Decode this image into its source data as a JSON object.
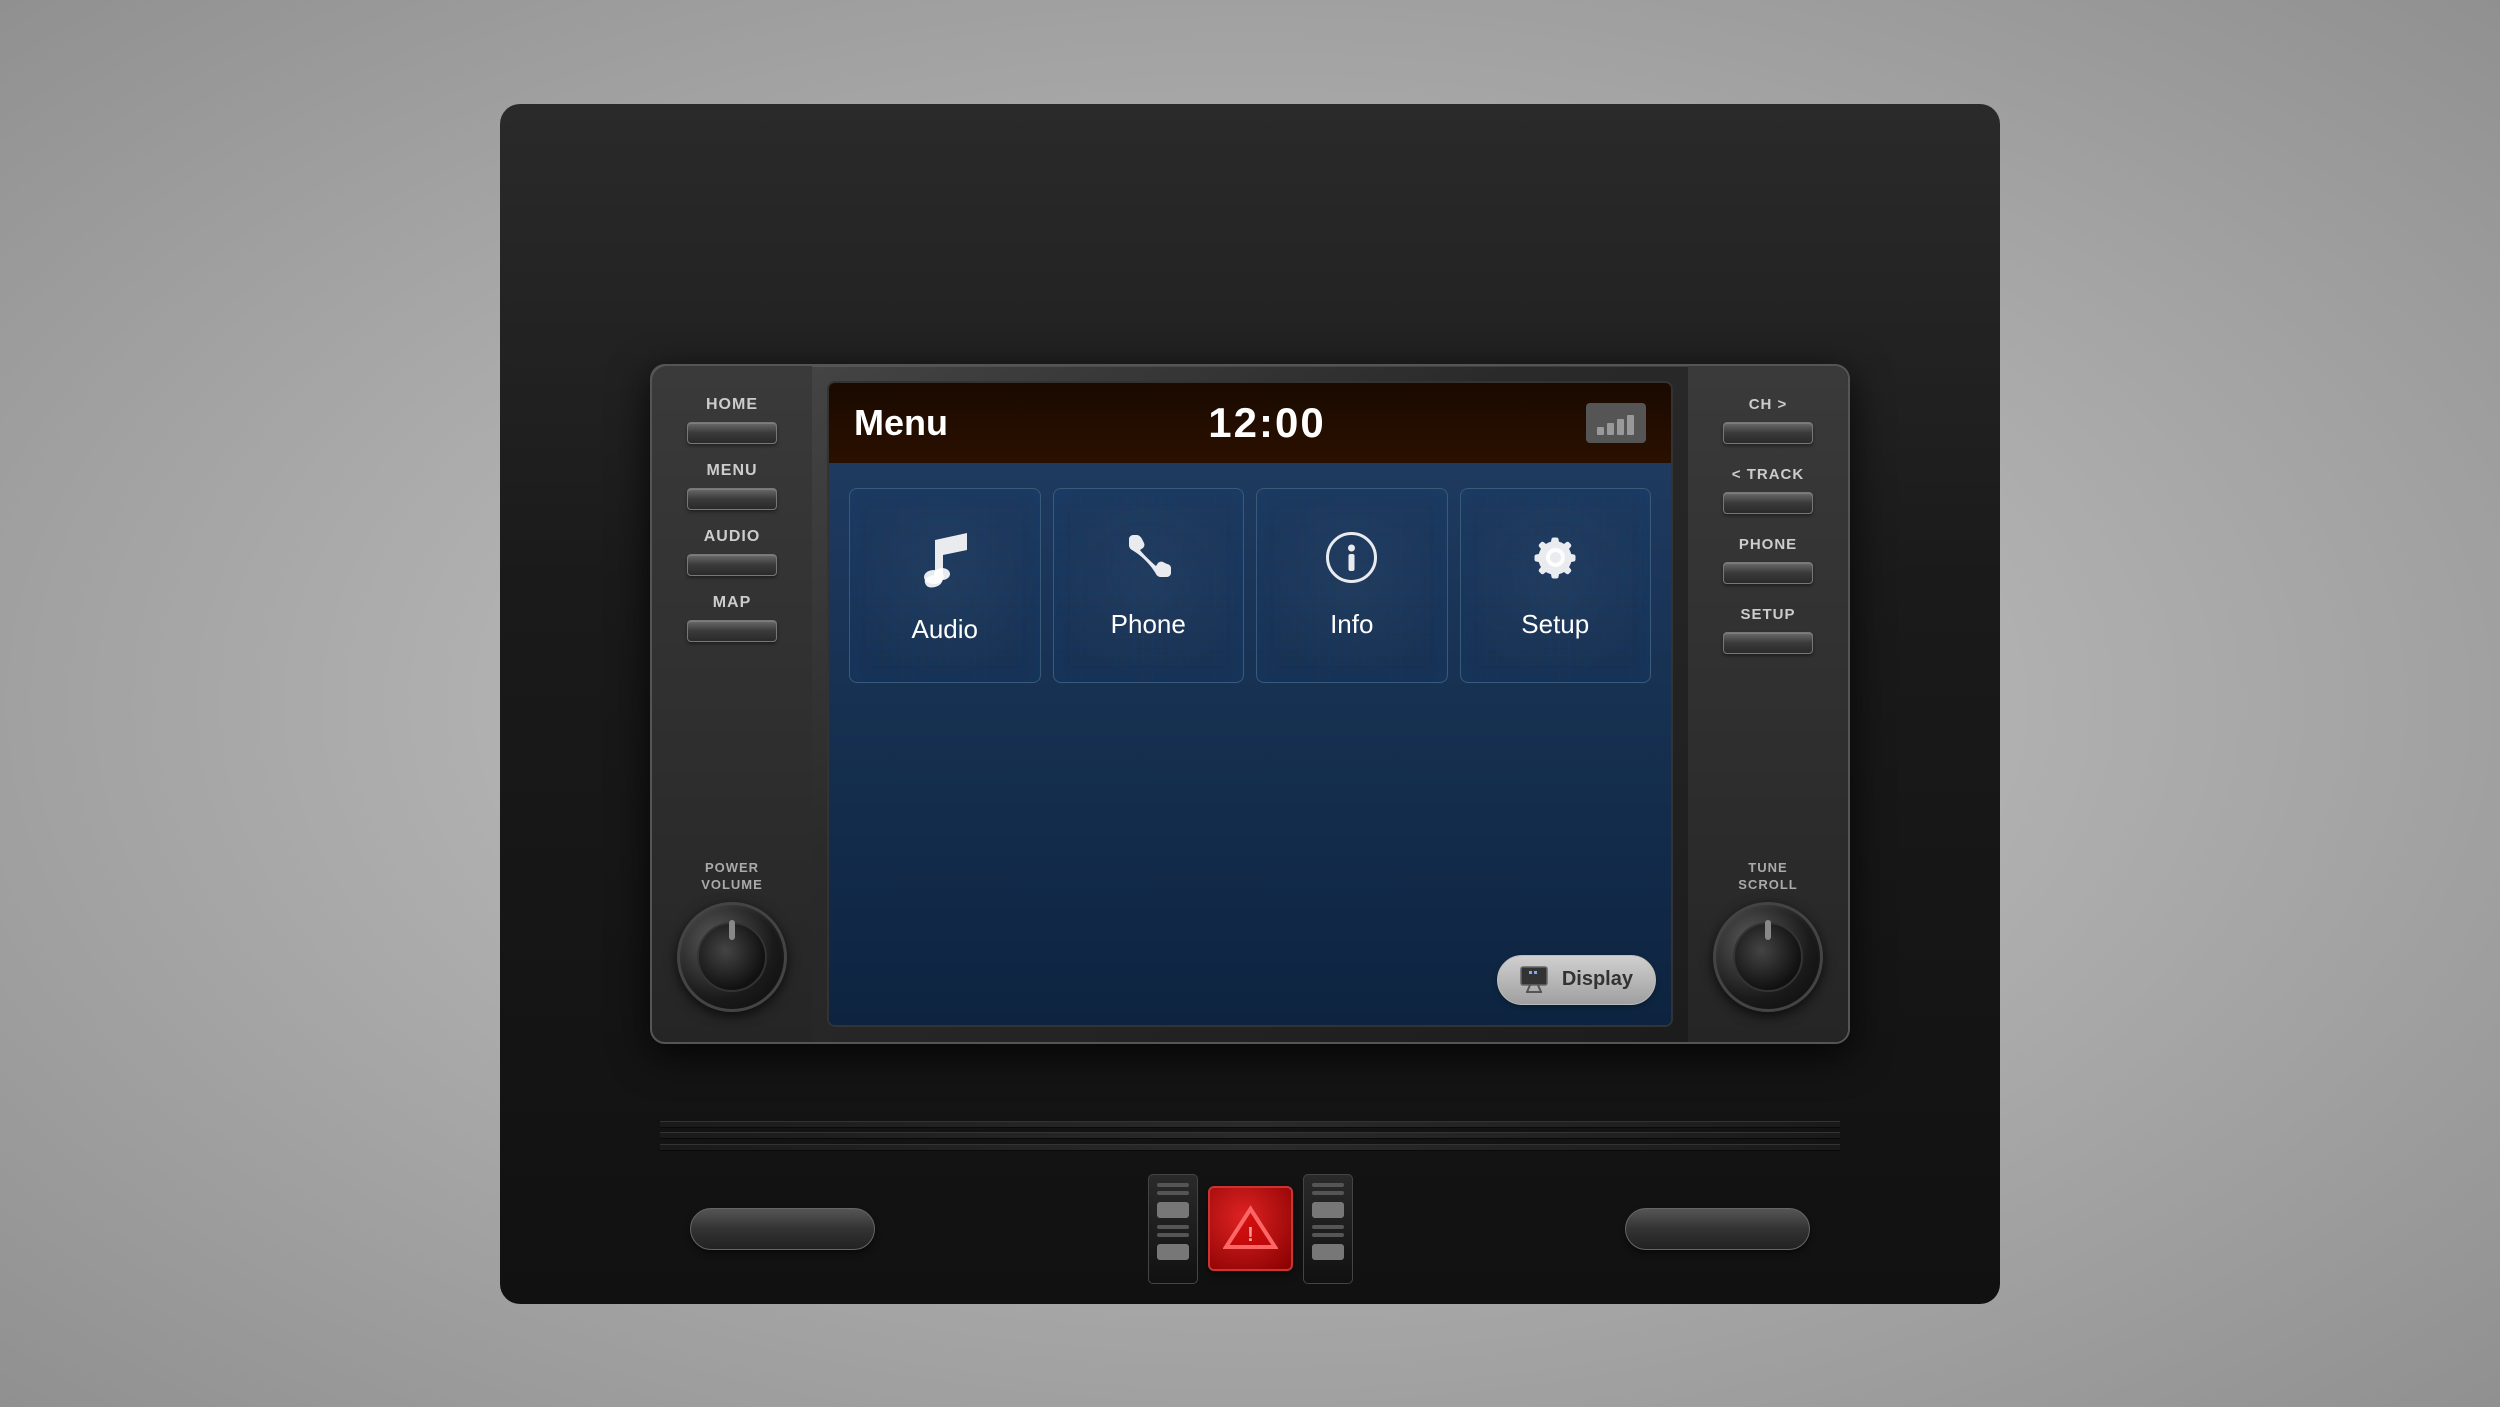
{
  "unit": {
    "left_panel": {
      "buttons": [
        {
          "label": "HOME",
          "id": "home"
        },
        {
          "label": "MENU",
          "id": "menu"
        },
        {
          "label": "AUDIO",
          "id": "audio"
        },
        {
          "label": "MAP",
          "id": "map"
        }
      ],
      "knob_label": "POWER\nVOLUME"
    },
    "right_panel": {
      "buttons": [
        {
          "label": "CH >",
          "id": "ch"
        },
        {
          "label": "< TRACK",
          "id": "track"
        },
        {
          "label": "PHONE",
          "id": "phone"
        },
        {
          "label": "SETUP",
          "id": "setup"
        }
      ],
      "knob_label": "TUNE\nSCROLL"
    },
    "screen": {
      "title": "Menu",
      "time": "12:00",
      "menu_items": [
        {
          "label": "Audio",
          "icon": "music-note"
        },
        {
          "label": "Phone",
          "icon": "phone"
        },
        {
          "label": "Info",
          "icon": "info-circle"
        },
        {
          "label": "Setup",
          "icon": "gear"
        }
      ],
      "display_button": "Display"
    }
  },
  "controls": {
    "hazard": "hazard-button",
    "left_btn": "left-push-button",
    "right_btn": "right-push-button"
  }
}
